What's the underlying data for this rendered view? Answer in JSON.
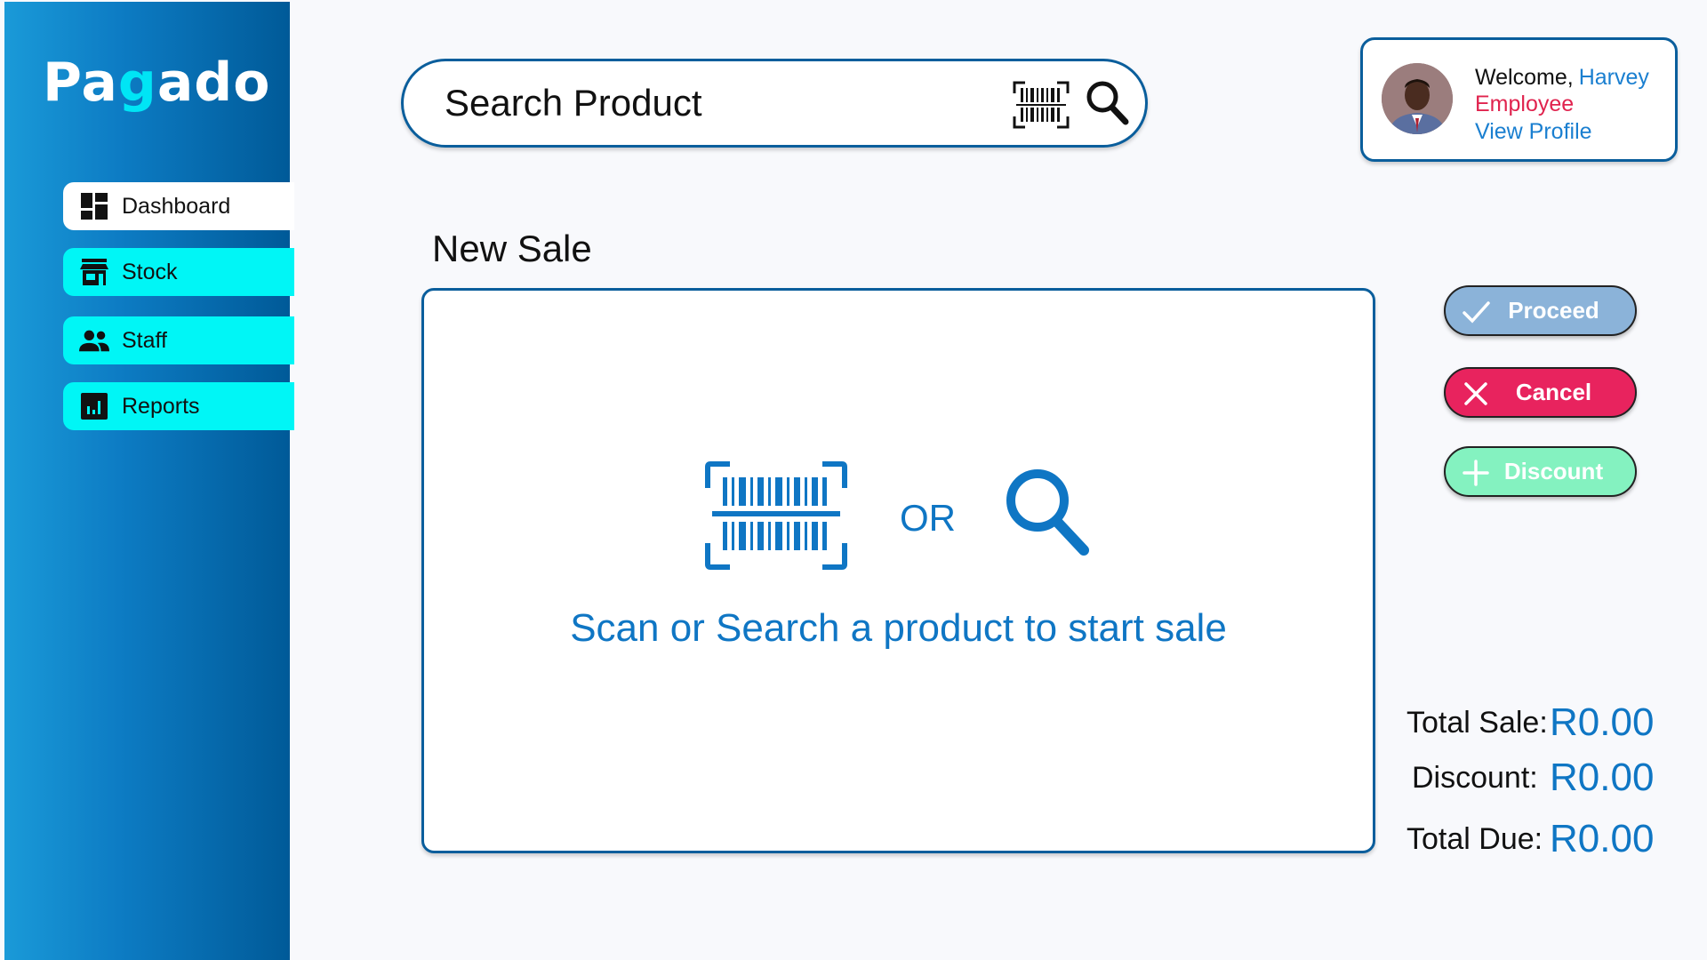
{
  "app": {
    "brand_prefix": "Pa",
    "brand_accent": "g",
    "brand_suffix": "ado"
  },
  "sidebar": {
    "items": [
      {
        "label": "Dashboard",
        "icon": "dashboard-icon",
        "active": true
      },
      {
        "label": "Stock",
        "icon": "store-icon",
        "active": false
      },
      {
        "label": "Staff",
        "icon": "people-icon",
        "active": false
      },
      {
        "label": "Reports",
        "icon": "bar-chart-icon",
        "active": false
      }
    ]
  },
  "search": {
    "placeholder": "Search Product",
    "icons": [
      "barcode-scan-icon",
      "search-icon"
    ]
  },
  "profile": {
    "welcome_label": "Welcome,",
    "name": "Harvey",
    "role": "Employee",
    "link_label": "View Profile"
  },
  "page": {
    "title": "New Sale"
  },
  "sale_panel": {
    "or_text": "OR",
    "message": "Scan or Search a product to start sale"
  },
  "actions": {
    "proceed": "Proceed",
    "cancel": "Cancel",
    "discount": "Discount"
  },
  "totals": {
    "total_sale_label": "Total Sale:",
    "total_sale_value": "R0.00",
    "discount_label": "Discount:",
    "discount_value": "R0.00",
    "total_due_label": "Total Due:",
    "total_due_value": "R0.00"
  },
  "colors": {
    "primary": "#0f76c4",
    "sidebar_start": "#1a9ad8",
    "sidebar_end": "#005a98",
    "nav_inactive": "#00f6f6",
    "proceed": "#8bb3d9",
    "cancel": "#e8235e",
    "discount": "#84f2c0",
    "role": "#e0234e"
  }
}
